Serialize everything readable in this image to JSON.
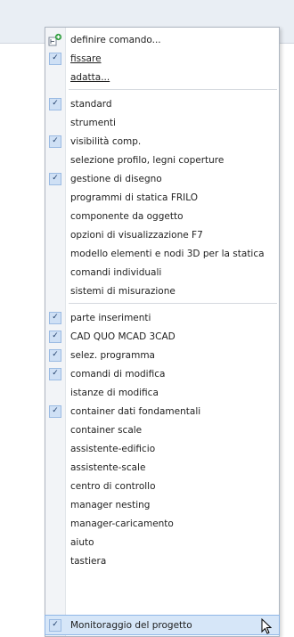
{
  "menu": {
    "items": [
      {
        "label": "definire comando...",
        "checked": false,
        "icon": "define-command-icon"
      },
      {
        "label": "fissare",
        "checked": true,
        "underline": true
      },
      {
        "label": "adatta...",
        "checked": false,
        "underline": true
      },
      {
        "label": "standard",
        "checked": true
      },
      {
        "label": "strumenti",
        "checked": false
      },
      {
        "label": "visibilità comp.",
        "checked": true
      },
      {
        "label": "selezione profilo, legni coperture",
        "checked": false
      },
      {
        "label": "gestione di disegno",
        "checked": true
      },
      {
        "label": "programmi di statica FRILO",
        "checked": false
      },
      {
        "label": "componente da oggetto",
        "checked": false
      },
      {
        "label": "opzioni di visualizzazione F7",
        "checked": false
      },
      {
        "label": "modello elementi e nodi 3D per la statica",
        "checked": false
      },
      {
        "label": "comandi individuali",
        "checked": false
      },
      {
        "label": "sistemi di misurazione",
        "checked": false
      },
      {
        "label": "parte inserimenti",
        "checked": true
      },
      {
        "label": "CAD QUO MCAD 3CAD",
        "checked": true
      },
      {
        "label": "selez. programma",
        "checked": true
      },
      {
        "label": "comandi di modifica",
        "checked": true
      },
      {
        "label": "istanze di modifica",
        "checked": false
      },
      {
        "label": "container dati fondamentali",
        "checked": true
      },
      {
        "label": "container scale",
        "checked": false
      },
      {
        "label": "assistente-edificio",
        "checked": false
      },
      {
        "label": "assistente-scale",
        "checked": false
      },
      {
        "label": "centro di controllo",
        "checked": false
      },
      {
        "label": "manager nesting",
        "checked": false
      },
      {
        "label": "manager-caricamento",
        "checked": false
      },
      {
        "label": "aiuto",
        "checked": false
      },
      {
        "label": "tastiera",
        "checked": false
      },
      {
        "label": "Monitoraggio del progetto",
        "checked": true,
        "hover": true
      }
    ]
  },
  "check_glyph": "✓",
  "colors": {
    "menu_hover": "#d6e6f8",
    "check_bg": "#cfe0f5",
    "toolbar_bg": "#e9eef4"
  }
}
